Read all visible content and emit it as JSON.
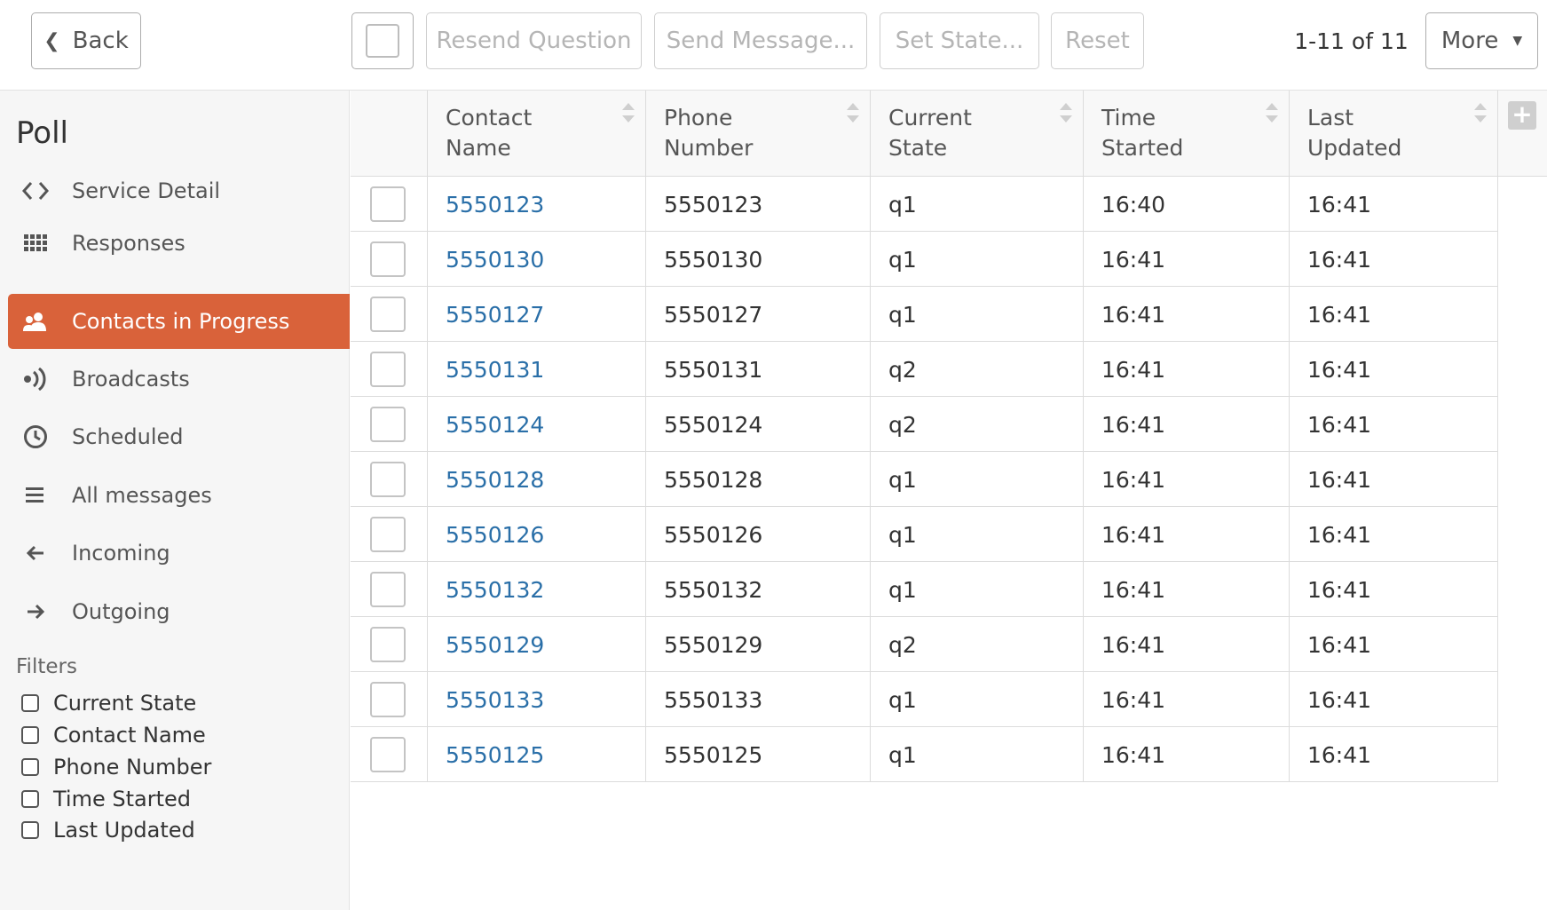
{
  "toolbar": {
    "back_label": "Back",
    "resend_label": "Resend Question",
    "send_message_label": "Send Message...",
    "set_state_label": "Set State...",
    "reset_label": "Reset",
    "pager_text": "1-11 of 11",
    "more_label": "More"
  },
  "sidebar": {
    "title": "Poll",
    "items": [
      {
        "label": "Service Detail",
        "icon": "code-icon"
      },
      {
        "label": "Responses",
        "icon": "grid-icon"
      },
      {
        "label": "Contacts in Progress",
        "icon": "users-icon",
        "active": true
      },
      {
        "label": "Broadcasts",
        "icon": "broadcast-icon"
      },
      {
        "label": "Scheduled",
        "icon": "clock-icon"
      },
      {
        "label": "All messages",
        "icon": "list-icon"
      },
      {
        "label": "Incoming",
        "icon": "arrow-left-icon"
      },
      {
        "label": "Outgoing",
        "icon": "arrow-right-icon"
      }
    ],
    "filters_title": "Filters",
    "filters": [
      "Current State",
      "Contact Name",
      "Phone Number",
      "Time Started",
      "Last Updated"
    ]
  },
  "table": {
    "columns": [
      {
        "line1": "Contact",
        "line2": "Name"
      },
      {
        "line1": "Phone",
        "line2": "Number"
      },
      {
        "line1": "Current",
        "line2": "State"
      },
      {
        "line1": "Time",
        "line2": "Started"
      },
      {
        "line1": "Last",
        "line2": "Updated"
      }
    ],
    "rows": [
      {
        "name": "5550123",
        "phone": "5550123",
        "state": "q1",
        "started": "16:40",
        "updated": "16:41"
      },
      {
        "name": "5550130",
        "phone": "5550130",
        "state": "q1",
        "started": "16:41",
        "updated": "16:41"
      },
      {
        "name": "5550127",
        "phone": "5550127",
        "state": "q1",
        "started": "16:41",
        "updated": "16:41"
      },
      {
        "name": "5550131",
        "phone": "5550131",
        "state": "q2",
        "started": "16:41",
        "updated": "16:41"
      },
      {
        "name": "5550124",
        "phone": "5550124",
        "state": "q2",
        "started": "16:41",
        "updated": "16:41"
      },
      {
        "name": "5550128",
        "phone": "5550128",
        "state": "q1",
        "started": "16:41",
        "updated": "16:41"
      },
      {
        "name": "5550126",
        "phone": "5550126",
        "state": "q1",
        "started": "16:41",
        "updated": "16:41"
      },
      {
        "name": "5550132",
        "phone": "5550132",
        "state": "q1",
        "started": "16:41",
        "updated": "16:41"
      },
      {
        "name": "5550129",
        "phone": "5550129",
        "state": "q2",
        "started": "16:41",
        "updated": "16:41"
      },
      {
        "name": "5550133",
        "phone": "5550133",
        "state": "q1",
        "started": "16:41",
        "updated": "16:41"
      },
      {
        "name": "5550125",
        "phone": "5550125",
        "state": "q1",
        "started": "16:41",
        "updated": "16:41"
      }
    ]
  },
  "colors": {
    "accent": "#d9623a",
    "link": "#2a6fa8"
  }
}
